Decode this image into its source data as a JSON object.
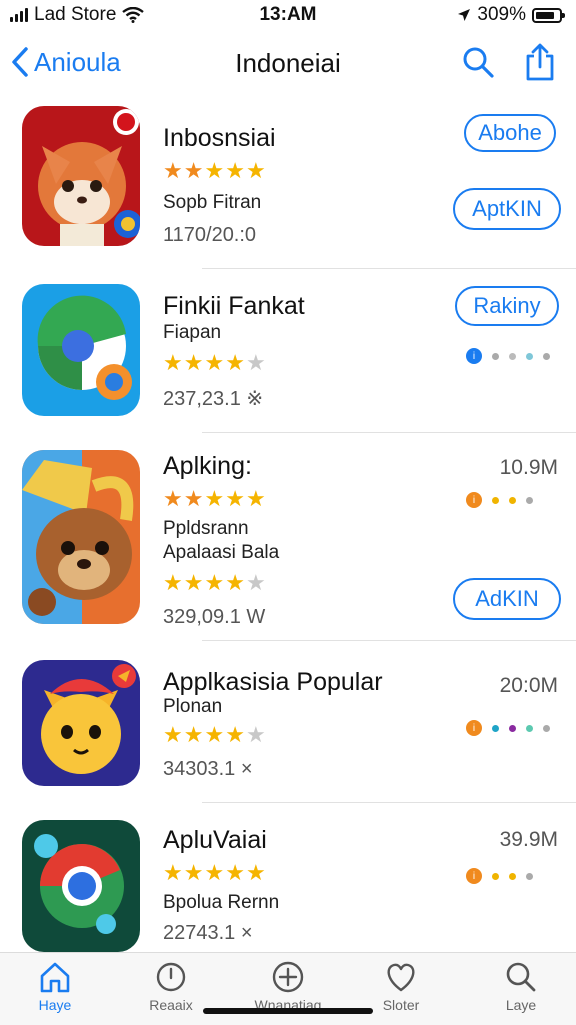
{
  "status": {
    "carrier": "Lad Store",
    "time": "13:AM",
    "battery": "309%",
    "battery_level": 0.8
  },
  "nav": {
    "back_label": "Anioula",
    "title": "Indoneiai"
  },
  "apps": [
    {
      "name": "Inbosnsiai",
      "rating": 4.5,
      "subtitle": "Sopb Fitran",
      "meta": "1170/20.:0",
      "button_top": "Abohe",
      "button_bottom": "AptKIN"
    },
    {
      "name": "Finkii Fankat",
      "subtitle": "Fiapan",
      "rating": 3.5,
      "meta": "237,23.1 ※",
      "button_top": "Rakiny"
    },
    {
      "name": "Aplking:",
      "size": "10.9M",
      "rating": 4.5,
      "subtitle": "Ppldsrann",
      "subtitle2": "Apalaasi Bala",
      "rating2": 3.5,
      "meta": "329,09.1 W",
      "button_bottom": "AdKIN"
    },
    {
      "name": "Applkasisia Popular",
      "size": "20:0M",
      "subtitle": "Plonan",
      "rating": 3.5,
      "meta": "34303.1 ×"
    },
    {
      "name": "ApluVaiai",
      "size": "39.9M",
      "rating": 4.5,
      "subtitle": "Bpolua Rernn",
      "meta": "22743.1 ×"
    }
  ],
  "tabs": [
    {
      "label": "Haye",
      "icon": "house-icon"
    },
    {
      "label": "Reaaix",
      "icon": "clock-icon"
    },
    {
      "label": "Wnanatiaq",
      "icon": "plus-circle-icon"
    },
    {
      "label": "Sloter",
      "icon": "heart-icon"
    },
    {
      "label": "Laye",
      "icon": "search-icon"
    }
  ],
  "colors": {
    "accent": "#1a7cf0",
    "star": "#f5b400",
    "star_orange": "#f08a1e"
  }
}
